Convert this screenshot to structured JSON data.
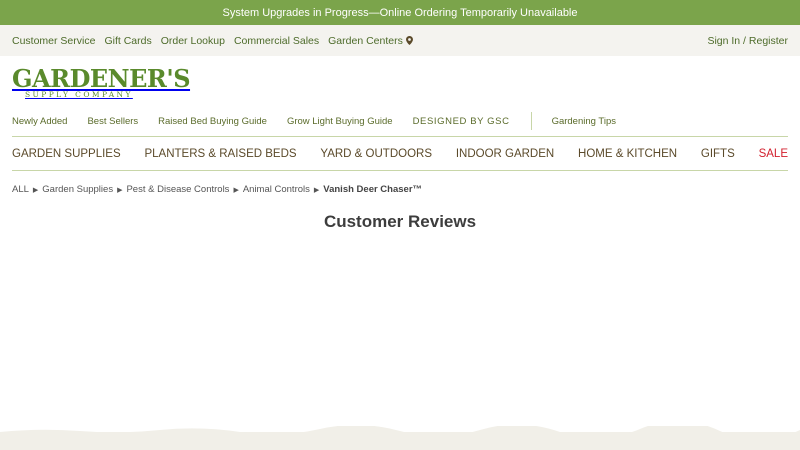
{
  "banner": {
    "text": "System Upgrades in Progress—Online Ordering Temporarily Unavailable"
  },
  "utility": {
    "links": [
      "Customer Service",
      "Gift Cards",
      "Order Lookup",
      "Commercial Sales",
      "Garden Centers"
    ],
    "account": "Sign In / Register"
  },
  "logo": {
    "main": "GARDENER'S",
    "sub": "SUPPLY COMPANY"
  },
  "secondary_nav": {
    "items": [
      "Newly Added",
      "Best Sellers",
      "Raised Bed Buying Guide",
      "Grow Light Buying Guide",
      "DESIGNED BY GSC"
    ],
    "tips": "Gardening Tips"
  },
  "main_nav": {
    "items": [
      "GARDEN SUPPLIES",
      "PLANTERS & RAISED BEDS",
      "YARD & OUTDOORS",
      "INDOOR GARDEN",
      "HOME & KITCHEN",
      "GIFTS",
      "SALE"
    ]
  },
  "breadcrumb": {
    "items": [
      "ALL",
      "Garden Supplies",
      "Pest & Disease Controls",
      "Animal Controls"
    ],
    "current": "Vanish Deer Chaser™",
    "separator": "▶"
  },
  "page": {
    "heading": "Customer Reviews"
  },
  "colors": {
    "banner": "#7ba44b",
    "sale": "#d21f2d",
    "brand": "#5a8a2c"
  },
  "icons": {
    "garden_centers": "map-pin-icon"
  }
}
